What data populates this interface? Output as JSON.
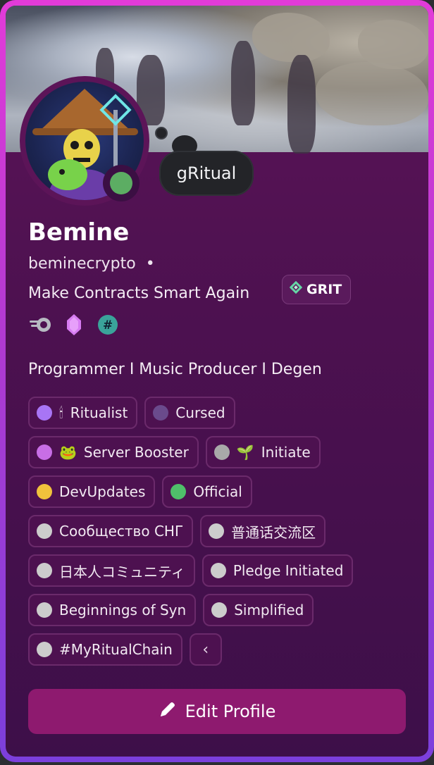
{
  "banner": {
    "description_icon": "banner-image"
  },
  "profile": {
    "display_name": "Bemine",
    "username": "beminecrypto",
    "separator": "•",
    "custom_status": "Make Contracts Smart Again",
    "guild_tag": {
      "label": "GRIT",
      "icon": "grit-diamond-icon"
    },
    "thought_bubble": "gRitual",
    "status_color": "#5cad63",
    "bio": "Programmer I Music Producer I Degen"
  },
  "badges": [
    {
      "name": "speed-badge-icon",
      "glyph": "◎"
    },
    {
      "name": "crystal-badge-icon",
      "glyph": "◆"
    },
    {
      "name": "hashtag-badge-icon",
      "glyph": "#"
    }
  ],
  "roles": [
    {
      "label": "Ritualist",
      "color": "#a875f5",
      "emoji": "🕯"
    },
    {
      "label": "Cursed",
      "color": "#6a4a8c",
      "emoji": ""
    },
    {
      "label": "Server Booster",
      "color": "#c86ee6",
      "emoji": "🐸"
    },
    {
      "label": "Initiate",
      "color": "#a9a9a9",
      "emoji": "🌱"
    },
    {
      "label": "DevUpdates",
      "color": "#f0c23c",
      "emoji": ""
    },
    {
      "label": "Official",
      "color": "#4fbf6a",
      "emoji": ""
    },
    {
      "label": "Сообщество СНГ",
      "color": "#cccccc",
      "emoji": ""
    },
    {
      "label": "普通话交流区",
      "color": "#cccccc",
      "emoji": ""
    },
    {
      "label": "日本人コミュニティ",
      "color": "#cccccc",
      "emoji": ""
    },
    {
      "label": "Pledge Initiated",
      "color": "#cccccc",
      "emoji": ""
    },
    {
      "label": "Beginnings of Syn",
      "color": "#cccccc",
      "emoji": ""
    },
    {
      "label": "Simplified",
      "color": "#cccccc",
      "emoji": ""
    },
    {
      "label": "#MyRitualChain",
      "color": "#cccccc",
      "emoji": ""
    }
  ],
  "collapse_glyph": "‹",
  "edit_button": {
    "label": "Edit Profile",
    "icon": "pencil-icon"
  },
  "colors": {
    "card_border": "#d13ad6",
    "card_bg": "#4d1150",
    "button_bg": "#8e1a6f"
  }
}
